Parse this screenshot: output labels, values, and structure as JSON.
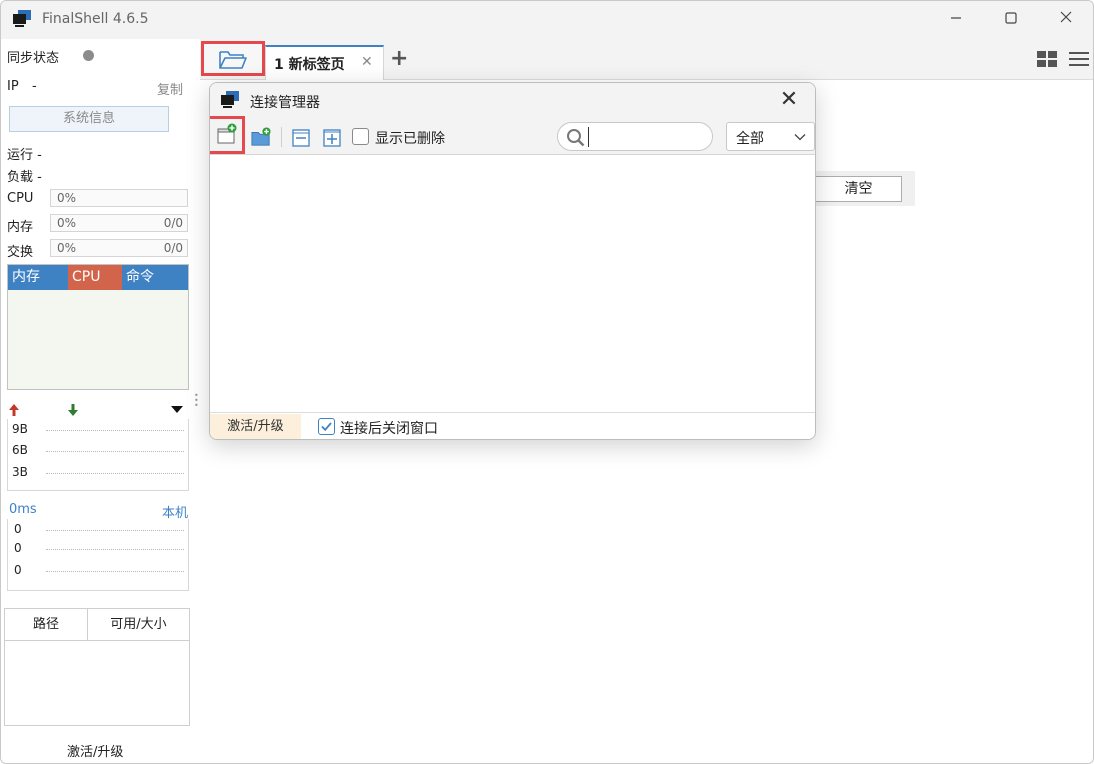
{
  "app": {
    "title": "FinalShell 4.6.5"
  },
  "sidebar": {
    "sync_label": "同步状态",
    "ip_label": "IP",
    "ip_value": "-",
    "copy": "复制",
    "sysinfo_button": "系统信息",
    "run_label": "运行 -",
    "load_label": "负载 -",
    "cpu": {
      "label": "CPU",
      "percent": "0%"
    },
    "mem": {
      "label": "内存",
      "percent": "0%",
      "total": "0/0"
    },
    "swap": {
      "label": "交换",
      "percent": "0%",
      "total": "0/0"
    },
    "proc_columns": [
      "内存",
      "CPU",
      "命令"
    ],
    "net_labels": [
      "9B",
      "6B",
      "3B"
    ],
    "ping": {
      "latency": "0ms",
      "host": "本机",
      "values": [
        "0",
        "0",
        "0"
      ]
    },
    "disk_columns": [
      "路径",
      "可用/大小"
    ],
    "activate": "激活/升级"
  },
  "tabs": [
    {
      "label": "1 新标签页"
    }
  ],
  "background": {
    "clear_button": "清空"
  },
  "dialog": {
    "title": "连接管理器",
    "show_deleted_label": "显示已删除",
    "search": {
      "value": "",
      "placeholder": ""
    },
    "filter": {
      "selected": "全部"
    },
    "footer": {
      "activate": "激活/升级",
      "close_after_connect_label": "连接后关闭窗口",
      "close_after_connect_checked": true
    }
  },
  "colors": {
    "accent": "#3f82c4",
    "highlight_red": "#e5484d",
    "cpu_header": "#d2644c",
    "upload_arrow": "#c0392b",
    "download_arrow": "#2e7d32"
  }
}
